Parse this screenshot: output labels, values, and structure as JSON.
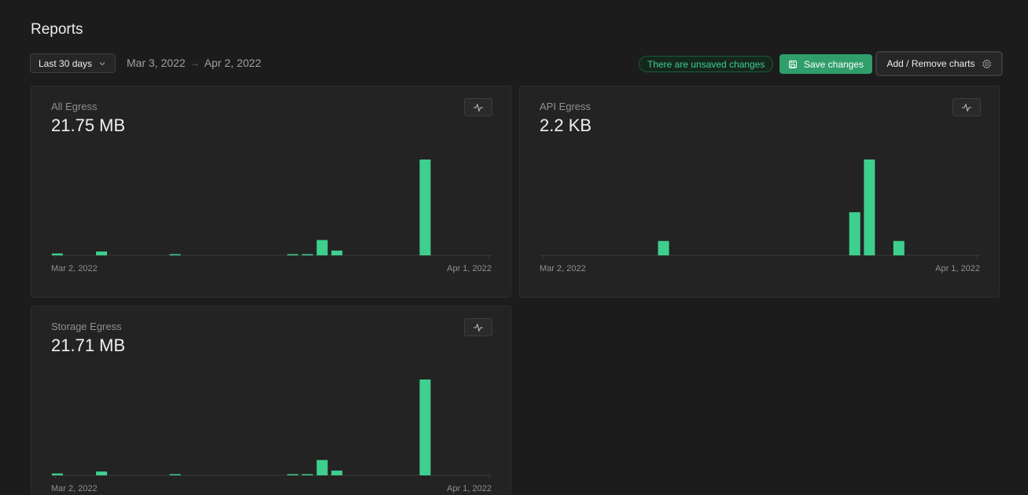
{
  "page": {
    "title": "Reports"
  },
  "toolbar": {
    "range_label": "Last 30 days",
    "date_start": "Mar 3, 2022",
    "date_end": "Apr 2, 2022",
    "unsaved_text": "There are unsaved changes",
    "save_label": "Save changes",
    "add_remove_label": "Add / Remove charts"
  },
  "colors": {
    "accent": "#3ecf8e",
    "background": "#1c1c1c",
    "card": "#232323"
  },
  "cards": [
    {
      "label": "All Egress",
      "value": "21.75 MB",
      "x_start": "Mar 2, 2022",
      "x_end": "Apr 1, 2022"
    },
    {
      "label": "API Egress",
      "value": "2.2 KB",
      "x_start": "Mar 2, 2022",
      "x_end": "Apr 1, 2022"
    },
    {
      "label": "Storage Egress",
      "value": "21.71 MB",
      "x_start": "Mar 2, 2022",
      "x_end": "Apr 1, 2022"
    }
  ],
  "chart_data": [
    {
      "type": "bar",
      "title": "All Egress",
      "x_range": [
        "Mar 2, 2022",
        "Apr 1, 2022"
      ],
      "values": [
        0.2,
        0,
        0,
        0.4,
        0,
        0,
        0,
        0,
        0.1,
        0,
        0,
        0,
        0,
        0,
        0,
        0,
        0.1,
        0.1,
        1.6,
        0.5,
        0,
        0,
        0,
        0,
        0,
        10.0,
        0,
        0,
        0,
        0,
        0
      ],
      "grid": false
    },
    {
      "type": "bar",
      "title": "API Egress",
      "x_range": [
        "Mar 2, 2022",
        "Apr 1, 2022"
      ],
      "values": [
        0,
        0,
        0,
        0,
        0,
        0,
        0,
        0,
        15,
        0,
        0,
        0,
        0,
        0,
        0,
        0,
        0,
        0,
        0,
        0,
        0,
        45,
        100,
        0,
        15,
        0,
        0,
        0,
        0,
        0,
        0
      ],
      "grid": false
    },
    {
      "type": "bar",
      "title": "Storage Egress",
      "x_range": [
        "Mar 2, 2022",
        "Apr 1, 2022"
      ],
      "values": [
        0.2,
        0,
        0,
        0.4,
        0,
        0,
        0,
        0,
        0.1,
        0,
        0,
        0,
        0,
        0,
        0,
        0,
        0.1,
        0.1,
        1.6,
        0.5,
        0,
        0,
        0,
        0,
        0,
        10.0,
        0,
        0,
        0,
        0,
        0
      ],
      "grid": false
    }
  ]
}
